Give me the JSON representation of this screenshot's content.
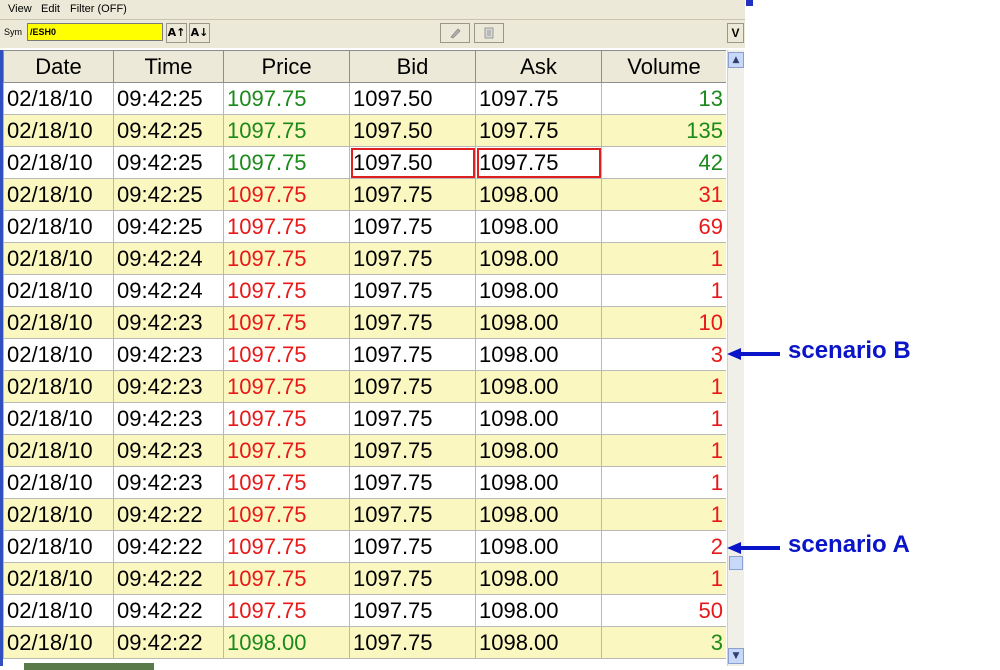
{
  "menu": {
    "view": "View",
    "edit": "Edit",
    "filter": "Filter (OFF)"
  },
  "toolbar": {
    "sym_label": "Sym",
    "sym_value": "/ESH0",
    "sort_up_label": "A↑",
    "sort_down_label": "A↓",
    "v_label": "V",
    "icons": [
      "pencil-icon",
      "document-icon"
    ]
  },
  "table": {
    "columns": [
      "Date",
      "Time",
      "Price",
      "Bid",
      "Ask",
      "Volume"
    ],
    "colors": {
      "up": "#1a8a1a",
      "down": "#e81818",
      "highlight_box": "#e02020",
      "odd_row_bg": "#fbf7c0"
    },
    "rows": [
      {
        "date": "02/18/10",
        "time": "09:42:25",
        "price": "1097.75",
        "bid": "1097.50",
        "ask": "1097.75",
        "volume": "13",
        "dir": "up"
      },
      {
        "date": "02/18/10",
        "time": "09:42:25",
        "price": "1097.75",
        "bid": "1097.50",
        "ask": "1097.75",
        "volume": "135",
        "dir": "up"
      },
      {
        "date": "02/18/10",
        "time": "09:42:25",
        "price": "1097.75",
        "bid": "1097.50",
        "ask": "1097.75",
        "volume": "42",
        "dir": "up",
        "boxed": true
      },
      {
        "date": "02/18/10",
        "time": "09:42:25",
        "price": "1097.75",
        "bid": "1097.75",
        "ask": "1098.00",
        "volume": "31",
        "dir": "down"
      },
      {
        "date": "02/18/10",
        "time": "09:42:25",
        "price": "1097.75",
        "bid": "1097.75",
        "ask": "1098.00",
        "volume": "69",
        "dir": "down"
      },
      {
        "date": "02/18/10",
        "time": "09:42:24",
        "price": "1097.75",
        "bid": "1097.75",
        "ask": "1098.00",
        "volume": "1",
        "dir": "down"
      },
      {
        "date": "02/18/10",
        "time": "09:42:24",
        "price": "1097.75",
        "bid": "1097.75",
        "ask": "1098.00",
        "volume": "1",
        "dir": "down"
      },
      {
        "date": "02/18/10",
        "time": "09:42:23",
        "price": "1097.75",
        "bid": "1097.75",
        "ask": "1098.00",
        "volume": "10",
        "dir": "down"
      },
      {
        "date": "02/18/10",
        "time": "09:42:23",
        "price": "1097.75",
        "bid": "1097.75",
        "ask": "1098.00",
        "volume": "3",
        "dir": "down"
      },
      {
        "date": "02/18/10",
        "time": "09:42:23",
        "price": "1097.75",
        "bid": "1097.75",
        "ask": "1098.00",
        "volume": "1",
        "dir": "down"
      },
      {
        "date": "02/18/10",
        "time": "09:42:23",
        "price": "1097.75",
        "bid": "1097.75",
        "ask": "1098.00",
        "volume": "1",
        "dir": "down"
      },
      {
        "date": "02/18/10",
        "time": "09:42:23",
        "price": "1097.75",
        "bid": "1097.75",
        "ask": "1098.00",
        "volume": "1",
        "dir": "down"
      },
      {
        "date": "02/18/10",
        "time": "09:42:23",
        "price": "1097.75",
        "bid": "1097.75",
        "ask": "1098.00",
        "volume": "1",
        "dir": "down"
      },
      {
        "date": "02/18/10",
        "time": "09:42:22",
        "price": "1097.75",
        "bid": "1097.75",
        "ask": "1098.00",
        "volume": "1",
        "dir": "down"
      },
      {
        "date": "02/18/10",
        "time": "09:42:22",
        "price": "1097.75",
        "bid": "1097.75",
        "ask": "1098.00",
        "volume": "2",
        "dir": "down"
      },
      {
        "date": "02/18/10",
        "time": "09:42:22",
        "price": "1097.75",
        "bid": "1097.75",
        "ask": "1098.00",
        "volume": "1",
        "dir": "down"
      },
      {
        "date": "02/18/10",
        "time": "09:42:22",
        "price": "1097.75",
        "bid": "1097.75",
        "ask": "1098.00",
        "volume": "50",
        "dir": "down"
      },
      {
        "date": "02/18/10",
        "time": "09:42:22",
        "price": "1098.00",
        "bid": "1097.75",
        "ask": "1098.00",
        "volume": "3",
        "dir": "up"
      }
    ]
  },
  "annotations": [
    {
      "label": "scenario B",
      "row": 8
    },
    {
      "label": "scenario A",
      "row": 14
    }
  ],
  "scrollbar": {
    "up_icon": "arrow-up-icon",
    "down_icon": "arrow-down-icon"
  },
  "annotation_color": "#0a14c8"
}
